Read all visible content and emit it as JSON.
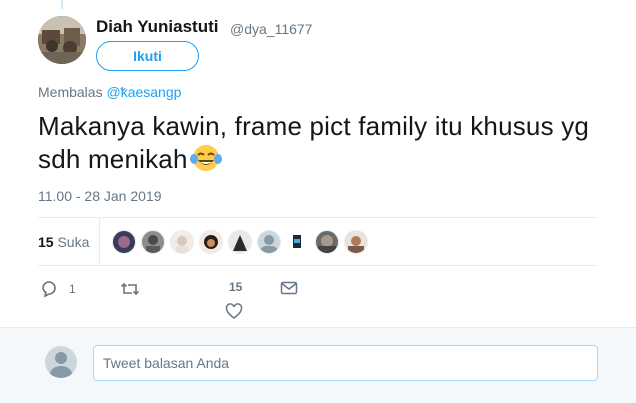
{
  "author": {
    "name": "Diah Yuniastuti",
    "handle": "@dya_11677",
    "follow_label": "Ikuti"
  },
  "reply_context": {
    "prefix": "Membalas",
    "mention": "@kaesangp"
  },
  "tweet": {
    "text": "Makanya kawin, frame pict family itu khusus yg sdh menikah",
    "emoji": "face-with-tears-of-joy-icon",
    "timestamp": "11.00 - 28 Jan 2019"
  },
  "stats": {
    "likes_count": "15",
    "likes_label": "Suka",
    "likers_count": 9
  },
  "actions": {
    "reply_count": "1",
    "retweet_count": "",
    "like_count": "15"
  },
  "composer": {
    "placeholder": "Tweet balasan Anda"
  },
  "colors": {
    "accent": "#1da1f2",
    "muted": "#657786",
    "border": "#e6ecf0"
  }
}
